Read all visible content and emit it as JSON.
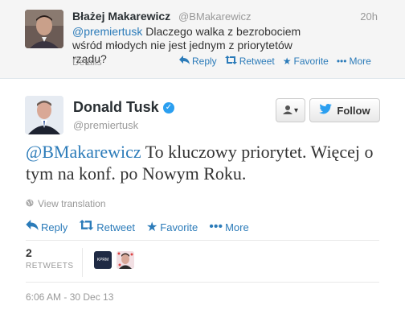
{
  "colors": {
    "link": "#2b7bb9",
    "verified": "#2b9ff0",
    "twitter_blue": "#2b9ff0"
  },
  "reply_tweet": {
    "name": "Błażej Makarewicz",
    "handle": "@BMakarewicz",
    "time": "20h",
    "mention": "@premiertusk",
    "text": "Dlaczego walka z bezrobociem wśród młodych nie jest jednym z priorytetów rządu?",
    "details": "Details",
    "actions": {
      "reply": "Reply",
      "retweet": "Retweet",
      "favorite": "Favorite",
      "more": "More"
    }
  },
  "main_tweet": {
    "name": "Donald Tusk",
    "handle": "@premiertusk",
    "follow_label": "Follow",
    "mention": "@BMakarewicz",
    "text": "To kluczowy priorytet. Więcej o tym na konf. po Nowym Roku.",
    "view_translation": "View translation",
    "actions": {
      "reply": "Reply",
      "retweet": "Retweet",
      "favorite": "Favorite",
      "more": "More"
    },
    "retweets_count": "2",
    "retweets_label": "RETWEETS",
    "retweeter_badge": "KPRM",
    "timestamp": "6:06 AM - 30 Dec 13"
  }
}
